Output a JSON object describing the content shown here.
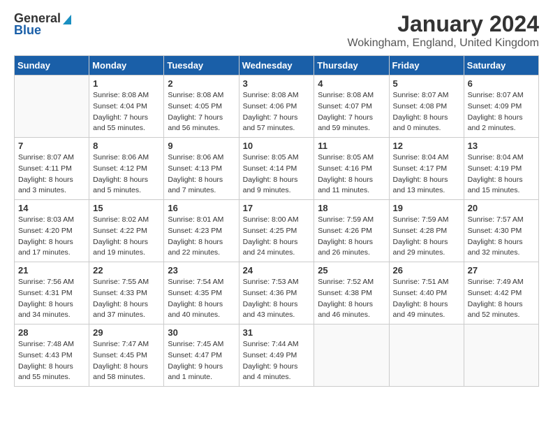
{
  "logo": {
    "general": "General",
    "blue": "Blue"
  },
  "title": "January 2024",
  "subtitle": "Wokingham, England, United Kingdom",
  "days_of_week": [
    "Sunday",
    "Monday",
    "Tuesday",
    "Wednesday",
    "Thursday",
    "Friday",
    "Saturday"
  ],
  "weeks": [
    [
      {
        "num": "",
        "info": ""
      },
      {
        "num": "1",
        "info": "Sunrise: 8:08 AM\nSunset: 4:04 PM\nDaylight: 7 hours\nand 55 minutes."
      },
      {
        "num": "2",
        "info": "Sunrise: 8:08 AM\nSunset: 4:05 PM\nDaylight: 7 hours\nand 56 minutes."
      },
      {
        "num": "3",
        "info": "Sunrise: 8:08 AM\nSunset: 4:06 PM\nDaylight: 7 hours\nand 57 minutes."
      },
      {
        "num": "4",
        "info": "Sunrise: 8:08 AM\nSunset: 4:07 PM\nDaylight: 7 hours\nand 59 minutes."
      },
      {
        "num": "5",
        "info": "Sunrise: 8:07 AM\nSunset: 4:08 PM\nDaylight: 8 hours\nand 0 minutes."
      },
      {
        "num": "6",
        "info": "Sunrise: 8:07 AM\nSunset: 4:09 PM\nDaylight: 8 hours\nand 2 minutes."
      }
    ],
    [
      {
        "num": "7",
        "info": "Sunrise: 8:07 AM\nSunset: 4:11 PM\nDaylight: 8 hours\nand 3 minutes."
      },
      {
        "num": "8",
        "info": "Sunrise: 8:06 AM\nSunset: 4:12 PM\nDaylight: 8 hours\nand 5 minutes."
      },
      {
        "num": "9",
        "info": "Sunrise: 8:06 AM\nSunset: 4:13 PM\nDaylight: 8 hours\nand 7 minutes."
      },
      {
        "num": "10",
        "info": "Sunrise: 8:05 AM\nSunset: 4:14 PM\nDaylight: 8 hours\nand 9 minutes."
      },
      {
        "num": "11",
        "info": "Sunrise: 8:05 AM\nSunset: 4:16 PM\nDaylight: 8 hours\nand 11 minutes."
      },
      {
        "num": "12",
        "info": "Sunrise: 8:04 AM\nSunset: 4:17 PM\nDaylight: 8 hours\nand 13 minutes."
      },
      {
        "num": "13",
        "info": "Sunrise: 8:04 AM\nSunset: 4:19 PM\nDaylight: 8 hours\nand 15 minutes."
      }
    ],
    [
      {
        "num": "14",
        "info": "Sunrise: 8:03 AM\nSunset: 4:20 PM\nDaylight: 8 hours\nand 17 minutes."
      },
      {
        "num": "15",
        "info": "Sunrise: 8:02 AM\nSunset: 4:22 PM\nDaylight: 8 hours\nand 19 minutes."
      },
      {
        "num": "16",
        "info": "Sunrise: 8:01 AM\nSunset: 4:23 PM\nDaylight: 8 hours\nand 22 minutes."
      },
      {
        "num": "17",
        "info": "Sunrise: 8:00 AM\nSunset: 4:25 PM\nDaylight: 8 hours\nand 24 minutes."
      },
      {
        "num": "18",
        "info": "Sunrise: 7:59 AM\nSunset: 4:26 PM\nDaylight: 8 hours\nand 26 minutes."
      },
      {
        "num": "19",
        "info": "Sunrise: 7:59 AM\nSunset: 4:28 PM\nDaylight: 8 hours\nand 29 minutes."
      },
      {
        "num": "20",
        "info": "Sunrise: 7:57 AM\nSunset: 4:30 PM\nDaylight: 8 hours\nand 32 minutes."
      }
    ],
    [
      {
        "num": "21",
        "info": "Sunrise: 7:56 AM\nSunset: 4:31 PM\nDaylight: 8 hours\nand 34 minutes."
      },
      {
        "num": "22",
        "info": "Sunrise: 7:55 AM\nSunset: 4:33 PM\nDaylight: 8 hours\nand 37 minutes."
      },
      {
        "num": "23",
        "info": "Sunrise: 7:54 AM\nSunset: 4:35 PM\nDaylight: 8 hours\nand 40 minutes."
      },
      {
        "num": "24",
        "info": "Sunrise: 7:53 AM\nSunset: 4:36 PM\nDaylight: 8 hours\nand 43 minutes."
      },
      {
        "num": "25",
        "info": "Sunrise: 7:52 AM\nSunset: 4:38 PM\nDaylight: 8 hours\nand 46 minutes."
      },
      {
        "num": "26",
        "info": "Sunrise: 7:51 AM\nSunset: 4:40 PM\nDaylight: 8 hours\nand 49 minutes."
      },
      {
        "num": "27",
        "info": "Sunrise: 7:49 AM\nSunset: 4:42 PM\nDaylight: 8 hours\nand 52 minutes."
      }
    ],
    [
      {
        "num": "28",
        "info": "Sunrise: 7:48 AM\nSunset: 4:43 PM\nDaylight: 8 hours\nand 55 minutes."
      },
      {
        "num": "29",
        "info": "Sunrise: 7:47 AM\nSunset: 4:45 PM\nDaylight: 8 hours\nand 58 minutes."
      },
      {
        "num": "30",
        "info": "Sunrise: 7:45 AM\nSunset: 4:47 PM\nDaylight: 9 hours\nand 1 minute."
      },
      {
        "num": "31",
        "info": "Sunrise: 7:44 AM\nSunset: 4:49 PM\nDaylight: 9 hours\nand 4 minutes."
      },
      {
        "num": "",
        "info": ""
      },
      {
        "num": "",
        "info": ""
      },
      {
        "num": "",
        "info": ""
      }
    ]
  ]
}
